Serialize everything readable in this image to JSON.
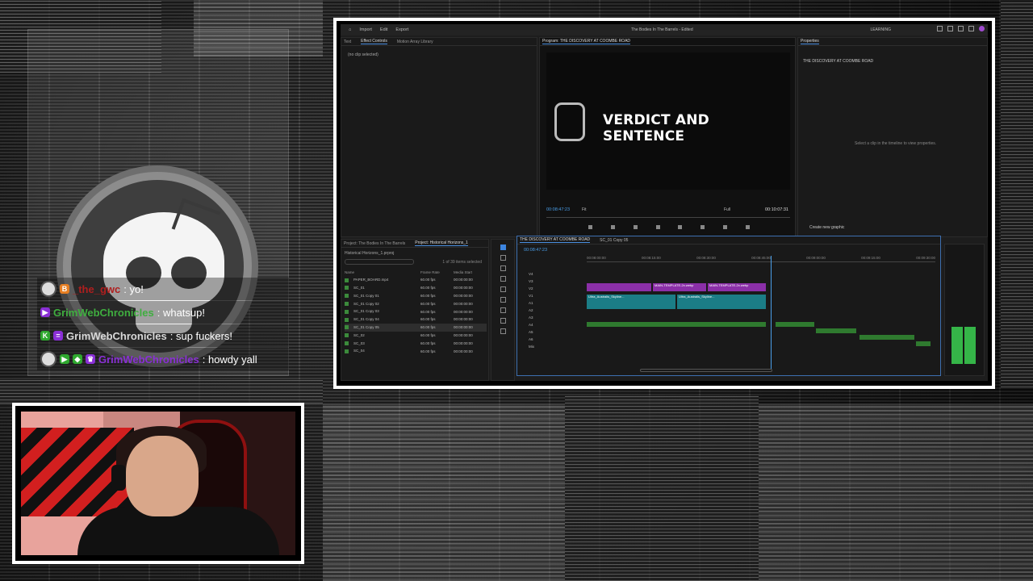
{
  "chat": {
    "messages": [
      {
        "user": "_the_gwc",
        "message": ": yo!",
        "user_color": "#b01e1e",
        "badges": [
          "B"
        ]
      },
      {
        "user": "GrimWebChronicles",
        "message": ": whatsup!",
        "user_color": "#3fae3f",
        "badges": [
          "▶"
        ]
      },
      {
        "user": "GrimWebChronicles",
        "message": ": sup fuckers!",
        "user_color": "#d9d9d9",
        "badges": [
          "K",
          "="
        ]
      },
      {
        "user": "GrimWebChronicles",
        "message": ": howdy yall",
        "user_color": "#8a2fd6",
        "badges": [
          "▶",
          "◆",
          "♛"
        ]
      }
    ]
  },
  "premiere": {
    "menu": [
      "Import",
      "Edit",
      "Export"
    ],
    "doc_title": "The Bodies In The Barrels - Edited",
    "workspace": "LEARNING",
    "effects_tabs": [
      "Text",
      "Effect Controls",
      "Motion Array Library"
    ],
    "no_clip": "(no clip selected)",
    "program_label": "Program: THE DISCOVERY AT COOMBE ROAD",
    "monitor_title": "VERDICT AND SENTENCE",
    "tc_current": "00:08:47:23",
    "tc_duration": "00:10:07:31",
    "fit": "Fit",
    "full": "Full",
    "properties_label": "Properties",
    "properties_seq": "THE DISCOVERY AT COOMBE ROAD",
    "properties_hint": "Select a clip in the timeline to view properties.",
    "create_graphic": "Create new graphic",
    "project_tabs": [
      "Project: The Bodies In The Barrels",
      "Project: Historical Horizons_1"
    ],
    "project_path": "Historical Horizons_1.prproj",
    "project_count": "1 of 39 items selected",
    "project_columns": [
      "Name",
      "Frame Rate",
      "Media Start"
    ],
    "project_items": [
      {
        "name": "PAPER_BOARD.mp4",
        "rate": "60.00 fps",
        "start": "00:00:00:00"
      },
      {
        "name": "SC_01",
        "rate": "60.00 fps",
        "start": "00:00:00:00"
      },
      {
        "name": "SC_01 Copy 01",
        "rate": "60.00 fps",
        "start": "00:00:00:00"
      },
      {
        "name": "SC_01 Copy 02",
        "rate": "60.00 fps",
        "start": "00:00:00:00"
      },
      {
        "name": "SC_01 Copy 03",
        "rate": "60.00 fps",
        "start": "00:00:00:00"
      },
      {
        "name": "SC_01 Copy 04",
        "rate": "60.00 fps",
        "start": "00:00:00:00"
      },
      {
        "name": "SC_01 Copy 05",
        "rate": "60.00 fps",
        "start": "00:00:00:00"
      },
      {
        "name": "SC_02",
        "rate": "60.00 fps",
        "start": "00:00:00:00"
      },
      {
        "name": "SC_03",
        "rate": "60.00 fps",
        "start": "00:00:00:00"
      },
      {
        "name": "SC_04",
        "rate": "60.00 fps",
        "start": "00:00:00:00"
      }
    ],
    "timeline_tabs": [
      "THE DISCOVERY AT COOMBE ROAD",
      "SC_01 Copy 05"
    ],
    "timeline_tc": "00:08:47:23",
    "ruler": [
      "00:08:00:00",
      "00:08:15:00",
      "00:08:30:00",
      "00:08:45:00",
      "00:09:00:00",
      "00:09:15:00",
      "00:09:30:00"
    ],
    "tracks": [
      "V4",
      "V3",
      "V2",
      "V1",
      "A1",
      "A2",
      "A3",
      "A4",
      "A5",
      "A6",
      "Mix"
    ],
    "clip_titles": [
      "MAIN-TEMPLATE-2x.webp",
      "MAIN-TEMPLATE-2x.webp"
    ],
    "clip_video": [
      "Ultra_Australis_Skyline...",
      "Ultra_Australis_Skyline..."
    ],
    "meter_value": 0.35
  }
}
